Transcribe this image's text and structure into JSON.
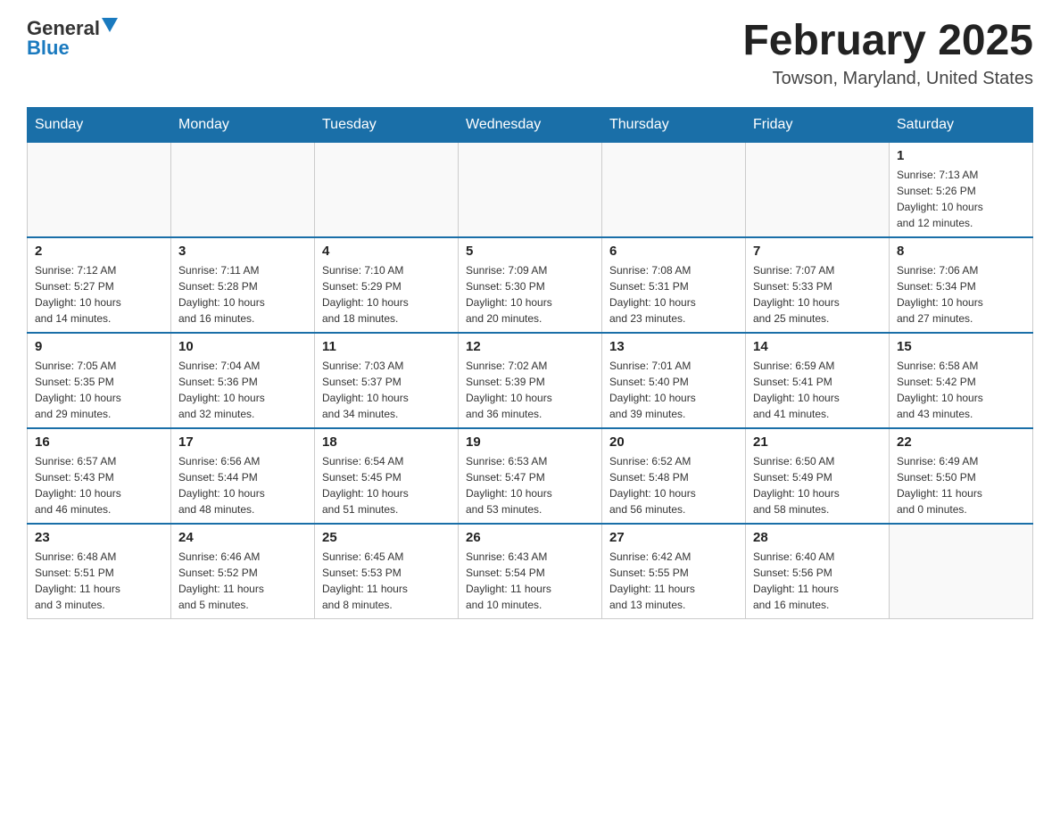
{
  "header": {
    "logo_general": "General",
    "logo_blue": "Blue",
    "month_title": "February 2025",
    "location": "Towson, Maryland, United States"
  },
  "days_of_week": [
    "Sunday",
    "Monday",
    "Tuesday",
    "Wednesday",
    "Thursday",
    "Friday",
    "Saturday"
  ],
  "weeks": [
    [
      {
        "day": "",
        "info": ""
      },
      {
        "day": "",
        "info": ""
      },
      {
        "day": "",
        "info": ""
      },
      {
        "day": "",
        "info": ""
      },
      {
        "day": "",
        "info": ""
      },
      {
        "day": "",
        "info": ""
      },
      {
        "day": "1",
        "info": "Sunrise: 7:13 AM\nSunset: 5:26 PM\nDaylight: 10 hours\nand 12 minutes."
      }
    ],
    [
      {
        "day": "2",
        "info": "Sunrise: 7:12 AM\nSunset: 5:27 PM\nDaylight: 10 hours\nand 14 minutes."
      },
      {
        "day": "3",
        "info": "Sunrise: 7:11 AM\nSunset: 5:28 PM\nDaylight: 10 hours\nand 16 minutes."
      },
      {
        "day": "4",
        "info": "Sunrise: 7:10 AM\nSunset: 5:29 PM\nDaylight: 10 hours\nand 18 minutes."
      },
      {
        "day": "5",
        "info": "Sunrise: 7:09 AM\nSunset: 5:30 PM\nDaylight: 10 hours\nand 20 minutes."
      },
      {
        "day": "6",
        "info": "Sunrise: 7:08 AM\nSunset: 5:31 PM\nDaylight: 10 hours\nand 23 minutes."
      },
      {
        "day": "7",
        "info": "Sunrise: 7:07 AM\nSunset: 5:33 PM\nDaylight: 10 hours\nand 25 minutes."
      },
      {
        "day": "8",
        "info": "Sunrise: 7:06 AM\nSunset: 5:34 PM\nDaylight: 10 hours\nand 27 minutes."
      }
    ],
    [
      {
        "day": "9",
        "info": "Sunrise: 7:05 AM\nSunset: 5:35 PM\nDaylight: 10 hours\nand 29 minutes."
      },
      {
        "day": "10",
        "info": "Sunrise: 7:04 AM\nSunset: 5:36 PM\nDaylight: 10 hours\nand 32 minutes."
      },
      {
        "day": "11",
        "info": "Sunrise: 7:03 AM\nSunset: 5:37 PM\nDaylight: 10 hours\nand 34 minutes."
      },
      {
        "day": "12",
        "info": "Sunrise: 7:02 AM\nSunset: 5:39 PM\nDaylight: 10 hours\nand 36 minutes."
      },
      {
        "day": "13",
        "info": "Sunrise: 7:01 AM\nSunset: 5:40 PM\nDaylight: 10 hours\nand 39 minutes."
      },
      {
        "day": "14",
        "info": "Sunrise: 6:59 AM\nSunset: 5:41 PM\nDaylight: 10 hours\nand 41 minutes."
      },
      {
        "day": "15",
        "info": "Sunrise: 6:58 AM\nSunset: 5:42 PM\nDaylight: 10 hours\nand 43 minutes."
      }
    ],
    [
      {
        "day": "16",
        "info": "Sunrise: 6:57 AM\nSunset: 5:43 PM\nDaylight: 10 hours\nand 46 minutes."
      },
      {
        "day": "17",
        "info": "Sunrise: 6:56 AM\nSunset: 5:44 PM\nDaylight: 10 hours\nand 48 minutes."
      },
      {
        "day": "18",
        "info": "Sunrise: 6:54 AM\nSunset: 5:45 PM\nDaylight: 10 hours\nand 51 minutes."
      },
      {
        "day": "19",
        "info": "Sunrise: 6:53 AM\nSunset: 5:47 PM\nDaylight: 10 hours\nand 53 minutes."
      },
      {
        "day": "20",
        "info": "Sunrise: 6:52 AM\nSunset: 5:48 PM\nDaylight: 10 hours\nand 56 minutes."
      },
      {
        "day": "21",
        "info": "Sunrise: 6:50 AM\nSunset: 5:49 PM\nDaylight: 10 hours\nand 58 minutes."
      },
      {
        "day": "22",
        "info": "Sunrise: 6:49 AM\nSunset: 5:50 PM\nDaylight: 11 hours\nand 0 minutes."
      }
    ],
    [
      {
        "day": "23",
        "info": "Sunrise: 6:48 AM\nSunset: 5:51 PM\nDaylight: 11 hours\nand 3 minutes."
      },
      {
        "day": "24",
        "info": "Sunrise: 6:46 AM\nSunset: 5:52 PM\nDaylight: 11 hours\nand 5 minutes."
      },
      {
        "day": "25",
        "info": "Sunrise: 6:45 AM\nSunset: 5:53 PM\nDaylight: 11 hours\nand 8 minutes."
      },
      {
        "day": "26",
        "info": "Sunrise: 6:43 AM\nSunset: 5:54 PM\nDaylight: 11 hours\nand 10 minutes."
      },
      {
        "day": "27",
        "info": "Sunrise: 6:42 AM\nSunset: 5:55 PM\nDaylight: 11 hours\nand 13 minutes."
      },
      {
        "day": "28",
        "info": "Sunrise: 6:40 AM\nSunset: 5:56 PM\nDaylight: 11 hours\nand 16 minutes."
      },
      {
        "day": "",
        "info": ""
      }
    ]
  ]
}
